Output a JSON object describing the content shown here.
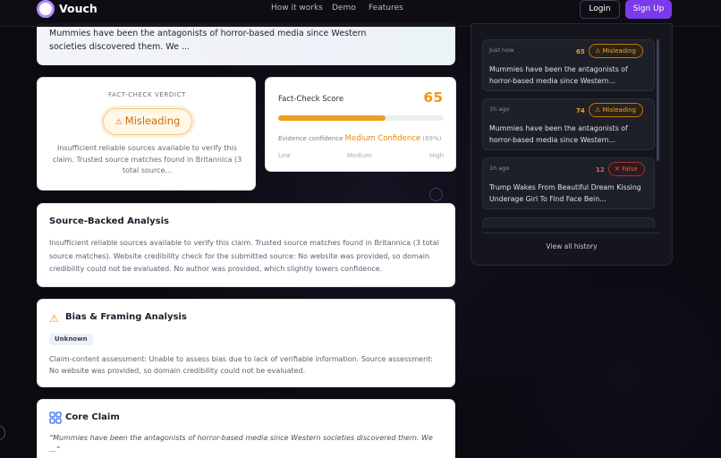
{
  "nav": {
    "brand": "Vouch",
    "links": [
      "How it works",
      "Demo",
      "Features"
    ],
    "login": "Login",
    "signup": "Sign Up"
  },
  "claim_preview": {
    "text": "Mummies have been the antagonists of horror-based media since Western societies discovered them. We ..."
  },
  "verdict": {
    "label": "FACT-CHECK VERDICT",
    "value": "Misleading",
    "icon": "warning-triangle-icon",
    "description": "Insufficient reliable sources available to verify this claim. Trusted source matches found in Britannica (3 total source..."
  },
  "score": {
    "title": "Fact-Check Score",
    "value": "65",
    "fill_percent": 65,
    "evidence_label": "Evidence confidence",
    "confidence_level": "Medium Confidence",
    "confidence_pct": "(69%)",
    "scale": [
      "Low",
      "Medium",
      "High"
    ]
  },
  "analysis": {
    "title": "Source-Backed Analysis",
    "body": "Insufficient reliable sources available to verify this claim. Trusted source matches found in Britannica (3 total source matches). Website credibility check for the submitted source: No website was provided, so domain credibility could not be evaluated. No author was provided, which slightly lowers confidence."
  },
  "bias": {
    "title": "Bias & Framing Analysis",
    "badge": "Unknown",
    "body": "Claim-content assessment: Unable to assess bias due to lack of verifiable information. Source assessment: No website was provided, so domain credibility could not be evaluated."
  },
  "core_claim": {
    "title": "Core Claim",
    "body": "“Mummies have been the antagonists of horror-based media since Western societies discovered them. We ...”"
  },
  "history": {
    "items": [
      {
        "time": "Just now",
        "score": "65",
        "verdict": "Misleading",
        "text": "Mummies have been the antagonists of horror-based media since Western..."
      },
      {
        "time": "1h ago",
        "score": "74",
        "verdict": "Misleading",
        "text": "Mummies have been the antagonists of horror-based media since Western..."
      },
      {
        "time": "1h ago",
        "score": "12",
        "verdict": "False",
        "text": "Trump Wakes From Beautiful Dream Kissing Underage Girl To Find Face Bein..."
      }
    ],
    "view_all": "View all history"
  },
  "colors": {
    "accent_purple": "#7b3bed",
    "misleading_orange": "#ea9a14",
    "false_red": "#ef5b53"
  }
}
